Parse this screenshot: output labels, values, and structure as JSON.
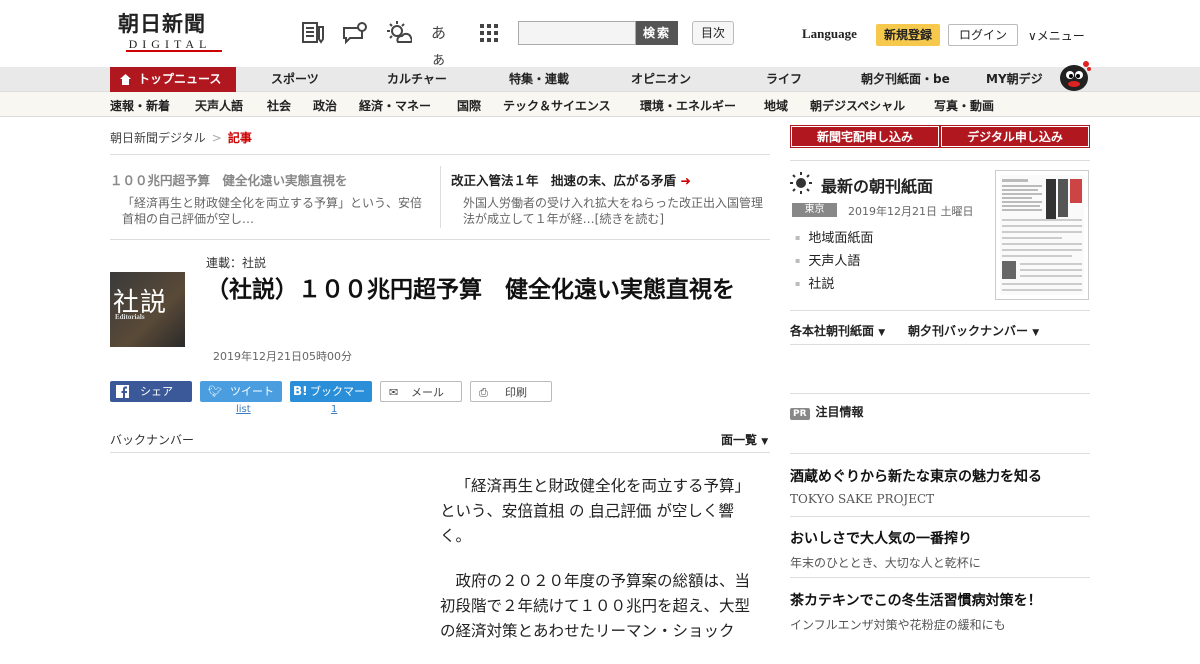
{
  "header": {
    "logo_main": "朝日新聞",
    "logo_sub": "DIGITAL",
    "search_button": "検索",
    "toc_button": "目次",
    "language": "Language",
    "register": "新規登録",
    "login": "ログイン",
    "menu": "メニュー"
  },
  "icons": [
    "newspaper-icon",
    "chat-bubble-icon",
    "weather-sun-icon",
    "font-size-icon",
    "app-grid-icon"
  ],
  "font_size_glyph": "あぁ",
  "nav_main": [
    "トップニュース",
    "スポーツ",
    "カルチャー",
    "特集・連載",
    "オピニオン",
    "ライフ",
    "朝夕刊紙面・be",
    "MY朝デジ"
  ],
  "nav_sub": [
    "速報・新着",
    "天声人語",
    "社会",
    "政治",
    "経済・マネー",
    "国際",
    "テック＆サイエンス",
    "環境・エネルギー",
    "地域",
    "朝デジスペシャル",
    "写真・動画"
  ],
  "breadcrumb": {
    "root": "朝日新聞デジタル",
    "sep": ">",
    "current": "記事"
  },
  "related": [
    {
      "headline": "１００兆円超予算　健全化遠い実態直視を",
      "summary": "「経済再生と財政健全化を両立する予算」という、安倍首相の自己評価が空し…"
    },
    {
      "headline": "改正入管法１年　拙速の末、広がる矛盾",
      "summary": "外国人労働者の受け入れ拡大をねらった改正出入国管理法が成立して１年が経…[続きを読む]"
    }
  ],
  "article": {
    "thumb_kanji": "社説",
    "thumb_en": "Editorials",
    "series": "連載：社説",
    "title": "（社説）１００兆円超予算　健全化遠い実態直視を",
    "date": "2019年12月21日05時00分",
    "p1a": "「経済再生と財政健全化を両立する予算」という、",
    "p1_link1": "安倍首相",
    "p1_mid": "の",
    "p1_link2": "自己評価",
    "p1b": "が空しく響く。",
    "p2": "政府の２０２０年度の予算案の総額は、当初段階で２年続けて１００兆円を超え、大型の経済対策とあわせたリーマン・ショック"
  },
  "share": {
    "facebook": "シェア",
    "twitter": "ツイート",
    "hatena": "ブックマーク",
    "hatena_logo": "B!",
    "mail": "メール",
    "print": "印刷",
    "twitter_count": "list",
    "hatena_count": "1"
  },
  "backnumber": {
    "label": "バックナンバー",
    "list": "面一覧"
  },
  "sidebar": {
    "sub_home": "新聞宅配申し込み",
    "sub_digital": "デジタル申し込み",
    "latest_title": "最新の朝刊紙面",
    "region": "東京",
    "paper_date": "2019年12月21日 土曜日",
    "paper_links": [
      "地域面紙面",
      "天声人語",
      "社説"
    ],
    "dropdown1": "各本社朝刊紙面",
    "dropdown2": "朝夕刊バックナンバー",
    "pr_badge": "PR",
    "pr_title": "注目情報",
    "ads": [
      {
        "title": "酒蔵めぐりから新たな東京の魅力を知る",
        "sub": "TOKYO SAKE PROJECT"
      },
      {
        "title": "おいしさで大人気の一番搾り",
        "sub": "年末のひととき、大切な人と乾杯に"
      },
      {
        "title": "茶カテキンでこの冬生活習慣病対策を！",
        "sub": "インフルエンザ対策や花粉症の緩和にも"
      }
    ]
  },
  "colors": {
    "brand_red": "#b0171f",
    "register_yellow": "#f6c84c",
    "facebook": "#3b5998",
    "twitter": "#4a9ee0",
    "hatena": "#2a8fd8"
  }
}
